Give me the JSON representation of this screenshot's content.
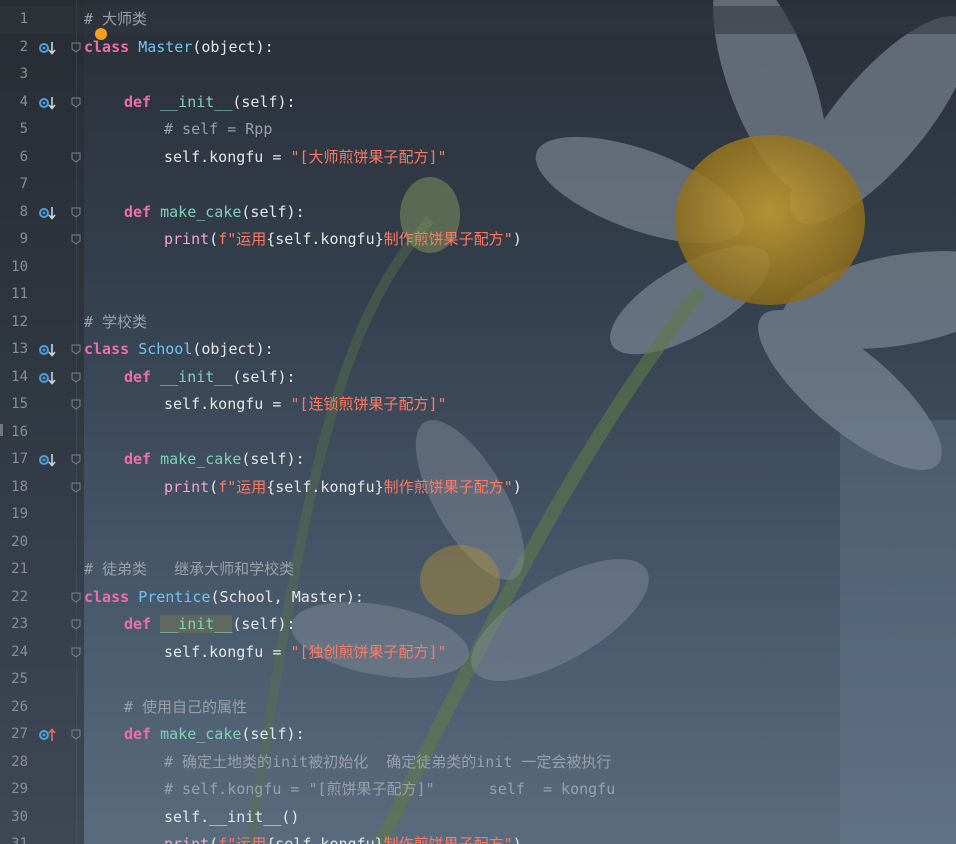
{
  "colors": {
    "keyword": "#f06fa8",
    "class_name": "#6ec6f0",
    "function_name": "#7fd1b9",
    "comment": "#9aa0a8",
    "string": "#ff7a62",
    "builtin": "#f0a5d8",
    "text": "#e6e6e6",
    "line_number": "#8a8f98",
    "gutter_icon": "#4aa3df"
  },
  "lines": [
    {
      "n": "1",
      "marker": "",
      "fold": false,
      "current": true,
      "indent": 0,
      "tokens": [
        {
          "t": "cm",
          "v": "# 大师类"
        }
      ]
    },
    {
      "n": "2",
      "marker": "override-down",
      "fold": true,
      "indent": 0,
      "tokens": [
        {
          "t": "kw",
          "v": "class"
        },
        {
          "t": "tx",
          "v": " "
        },
        {
          "t": "cls",
          "v": "Master"
        },
        {
          "t": "tx",
          "v": "(object):"
        }
      ]
    },
    {
      "n": "3",
      "marker": "",
      "fold": false,
      "indent": 0,
      "tokens": []
    },
    {
      "n": "4",
      "marker": "override-down",
      "fold": true,
      "indent": 1,
      "tokens": [
        {
          "t": "kw",
          "v": "def"
        },
        {
          "t": "tx",
          "v": " "
        },
        {
          "t": "fn",
          "v": "__init__"
        },
        {
          "t": "tx",
          "v": "(self):"
        }
      ]
    },
    {
      "n": "5",
      "marker": "",
      "fold": false,
      "indent": 2,
      "tokens": [
        {
          "t": "cm",
          "v": "# self = Rpp"
        }
      ]
    },
    {
      "n": "6",
      "marker": "",
      "fold": true,
      "indent": 2,
      "tokens": [
        {
          "t": "tx",
          "v": "self.kongfu = "
        },
        {
          "t": "str",
          "v": "\"[大师煎饼果子配方]\""
        }
      ]
    },
    {
      "n": "7",
      "marker": "",
      "fold": false,
      "indent": 0,
      "tokens": []
    },
    {
      "n": "8",
      "marker": "override-down",
      "fold": true,
      "indent": 1,
      "tokens": [
        {
          "t": "kw",
          "v": "def"
        },
        {
          "t": "tx",
          "v": " "
        },
        {
          "t": "fn",
          "v": "make_cake"
        },
        {
          "t": "tx",
          "v": "(self):"
        }
      ]
    },
    {
      "n": "9",
      "marker": "",
      "fold": true,
      "indent": 2,
      "tokens": [
        {
          "t": "pr",
          "v": "print"
        },
        {
          "t": "tx",
          "v": "("
        },
        {
          "t": "str",
          "v": "f\"运用"
        },
        {
          "t": "tx",
          "v": "{self.kongfu}"
        },
        {
          "t": "str",
          "v": "制作煎饼果子配方\""
        },
        {
          "t": "tx",
          "v": ")"
        }
      ]
    },
    {
      "n": "10",
      "marker": "",
      "fold": false,
      "indent": 0,
      "tokens": []
    },
    {
      "n": "11",
      "marker": "",
      "fold": false,
      "indent": 0,
      "tokens": []
    },
    {
      "n": "12",
      "marker": "",
      "fold": false,
      "indent": 0,
      "tokens": [
        {
          "t": "cm",
          "v": "# 学校类"
        }
      ]
    },
    {
      "n": "13",
      "marker": "override-down",
      "fold": true,
      "indent": 0,
      "tokens": [
        {
          "t": "kw",
          "v": "class"
        },
        {
          "t": "tx",
          "v": " "
        },
        {
          "t": "cls",
          "v": "School"
        },
        {
          "t": "tx",
          "v": "(object):"
        }
      ]
    },
    {
      "n": "14",
      "marker": "override-down",
      "fold": true,
      "indent": 1,
      "tokens": [
        {
          "t": "kw",
          "v": "def"
        },
        {
          "t": "tx",
          "v": " "
        },
        {
          "t": "fn",
          "v": "__init__"
        },
        {
          "t": "tx",
          "v": "(self):"
        }
      ]
    },
    {
      "n": "15",
      "marker": "",
      "fold": true,
      "indent": 2,
      "tokens": [
        {
          "t": "tx",
          "v": "self.kongfu = "
        },
        {
          "t": "str",
          "v": "\"[连锁煎饼果子配方]\""
        }
      ]
    },
    {
      "n": "16",
      "marker": "",
      "fold": false,
      "indent": 0,
      "tokens": []
    },
    {
      "n": "17",
      "marker": "override-down",
      "fold": true,
      "indent": 1,
      "tokens": [
        {
          "t": "kw",
          "v": "def"
        },
        {
          "t": "tx",
          "v": " "
        },
        {
          "t": "fn",
          "v": "make_cake"
        },
        {
          "t": "tx",
          "v": "(self):"
        }
      ]
    },
    {
      "n": "18",
      "marker": "",
      "fold": true,
      "indent": 2,
      "tokens": [
        {
          "t": "pr",
          "v": "print"
        },
        {
          "t": "tx",
          "v": "("
        },
        {
          "t": "str",
          "v": "f\"运用"
        },
        {
          "t": "tx",
          "v": "{self.kongfu}"
        },
        {
          "t": "str",
          "v": "制作煎饼果子配方\""
        },
        {
          "t": "tx",
          "v": ")"
        }
      ]
    },
    {
      "n": "19",
      "marker": "",
      "fold": false,
      "indent": 0,
      "tokens": []
    },
    {
      "n": "20",
      "marker": "",
      "fold": false,
      "indent": 0,
      "tokens": []
    },
    {
      "n": "21",
      "marker": "",
      "fold": false,
      "indent": 0,
      "tokens": [
        {
          "t": "cm",
          "v": "# 徒弟类   继承大师和学校类"
        }
      ]
    },
    {
      "n": "22",
      "marker": "",
      "fold": true,
      "indent": 0,
      "tokens": [
        {
          "t": "kw",
          "v": "class"
        },
        {
          "t": "tx",
          "v": " "
        },
        {
          "t": "cls",
          "v": "Prentice"
        },
        {
          "t": "tx",
          "v": "(School, Master):"
        }
      ]
    },
    {
      "n": "23",
      "marker": "",
      "fold": true,
      "indent": 1,
      "tokens": [
        {
          "t": "kw",
          "v": "def"
        },
        {
          "t": "tx",
          "v": " "
        },
        {
          "t": "fnh",
          "v": "__init__"
        },
        {
          "t": "tx",
          "v": "(self):"
        }
      ]
    },
    {
      "n": "24",
      "marker": "",
      "fold": true,
      "indent": 2,
      "tokens": [
        {
          "t": "tx",
          "v": "self.kongfu = "
        },
        {
          "t": "str",
          "v": "\"[独创煎饼果子配方]\""
        }
      ]
    },
    {
      "n": "25",
      "marker": "",
      "fold": false,
      "indent": 0,
      "tokens": []
    },
    {
      "n": "26",
      "marker": "",
      "fold": false,
      "indent": 1,
      "tokens": [
        {
          "t": "cm",
          "v": "# 使用自己的属性"
        }
      ]
    },
    {
      "n": "27",
      "marker": "override-up",
      "fold": true,
      "indent": 1,
      "tokens": [
        {
          "t": "kw",
          "v": "def"
        },
        {
          "t": "tx",
          "v": " "
        },
        {
          "t": "fn",
          "v": "make_cake"
        },
        {
          "t": "tx",
          "v": "(self):"
        }
      ]
    },
    {
      "n": "28",
      "marker": "",
      "fold": false,
      "indent": 2,
      "tokens": [
        {
          "t": "cm",
          "v": "# 确定土地类的init被初始化  确定徒弟类的init 一定会被执行"
        }
      ]
    },
    {
      "n": "29",
      "marker": "",
      "fold": false,
      "indent": 2,
      "tokens": [
        {
          "t": "cm",
          "v": "# self.kongfu = \"[煎饼果子配方]\"      self  = kongfu"
        }
      ]
    },
    {
      "n": "30",
      "marker": "",
      "fold": false,
      "indent": 2,
      "tokens": [
        {
          "t": "tx",
          "v": "self.__init__()"
        }
      ]
    },
    {
      "n": "31",
      "marker": "",
      "fold": false,
      "indent": 2,
      "tokens": [
        {
          "t": "pr",
          "v": "print"
        },
        {
          "t": "tx",
          "v": "("
        },
        {
          "t": "str",
          "v": "f\"运用"
        },
        {
          "t": "tx",
          "v": "{self.kongfu}"
        },
        {
          "t": "str",
          "v": "制作煎饼果子配方\""
        },
        {
          "t": "tx",
          "v": ")"
        }
      ]
    }
  ]
}
